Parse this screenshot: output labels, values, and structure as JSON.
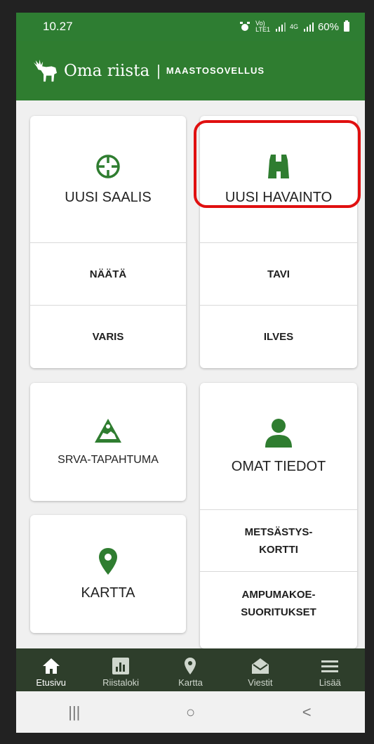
{
  "status_bar": {
    "time": "10.27",
    "volte_top": "Vo)",
    "volte_bottom": "LTE1",
    "network": "4G",
    "battery": "60%"
  },
  "app_bar": {
    "title": "Oma riista",
    "separator": "|",
    "subtitle": "MAASTOSOVELLUS"
  },
  "tiles": {
    "new_catch": {
      "label": "UUSI SAALIS",
      "icon": "crosshair-icon"
    },
    "catch_shortcuts": [
      "NÄÄTÄ",
      "VARIS"
    ],
    "new_observation": {
      "label": "UUSI HAVAINTO",
      "icon": "binoculars-icon"
    },
    "observation_shortcuts": [
      "TAVI",
      "ILVES"
    ],
    "srva": {
      "label": "SRVA-TAPAHTUMA",
      "icon": "srva-warning-icon"
    },
    "my_info": {
      "label": "OMAT TIEDOT",
      "icon": "person-icon"
    },
    "hunting_card": {
      "line1": "METSÄSTYS-",
      "line2": "KORTTI"
    },
    "shooting_tests": {
      "line1": "AMPUMAKOE-",
      "line2": "SUORITUKSET"
    },
    "map": {
      "label": "KARTTA",
      "icon": "map-pin-icon"
    }
  },
  "bottom_nav": [
    {
      "label": "Etusivu",
      "icon": "home-icon"
    },
    {
      "label": "Riistaloki",
      "icon": "chart-icon"
    },
    {
      "label": "Kartta",
      "icon": "pin-icon"
    },
    {
      "label": "Viestit",
      "icon": "envelope-icon"
    },
    {
      "label": "Lisää",
      "icon": "menu-icon"
    }
  ],
  "system_nav": {
    "recents": "|||",
    "home": "○",
    "back": "<"
  },
  "colors": {
    "brand_green": "#2f7d30",
    "nav_dark": "#2e3e2b",
    "highlight_red": "#e01010"
  }
}
